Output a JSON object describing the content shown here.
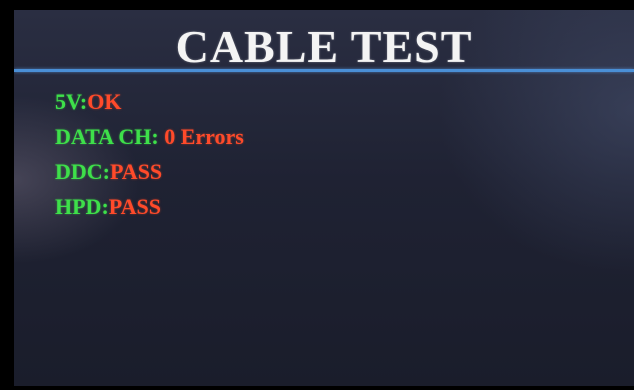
{
  "screen": {
    "title": "CABLE TEST",
    "results": [
      {
        "label": "5V:",
        "value": "OK"
      },
      {
        "label": "DATA CH: ",
        "value": "0 Errors"
      },
      {
        "label": "DDC:",
        "value": "PASS"
      },
      {
        "label": "HPD:",
        "value": "PASS"
      }
    ]
  },
  "colors": {
    "label_green": "#3ee04a",
    "value_red": "#ff4a2a",
    "divider_blue": "#4a8fd6",
    "title_white": "#f4f4f4"
  }
}
